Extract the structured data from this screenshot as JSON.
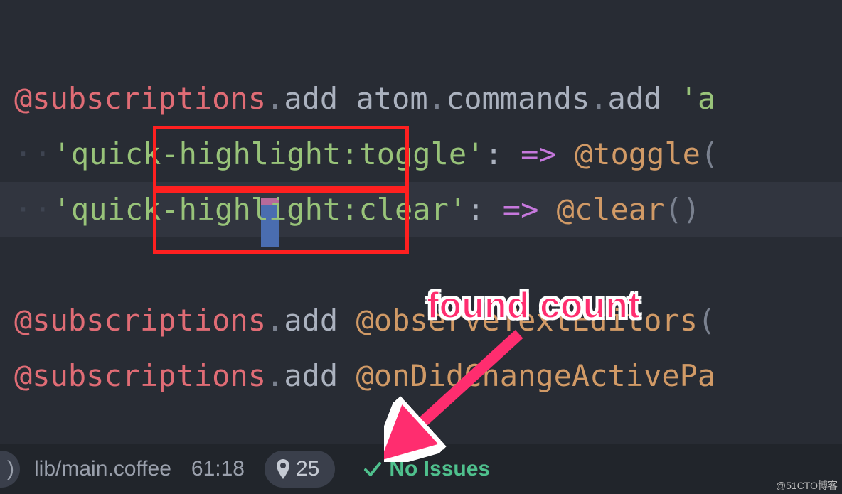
{
  "code": {
    "line1": {
      "at": "@",
      "subscriptions": "subscriptions",
      "dot1": ".",
      "add1": "add",
      "space1": " ",
      "atom": "atom",
      "dot2": ".",
      "commands": "commands",
      "dot3": ".",
      "add2": "add",
      "space2": " ",
      "quote": "'a"
    },
    "line2": {
      "indent": "··",
      "quote1": "'",
      "text": "quick-highlight:toggle",
      "quote2": "'",
      "colon": ":",
      "arrow": "=>",
      "at": "@",
      "toggle": "toggle",
      "paren": "("
    },
    "line3": {
      "indent": "··",
      "quote1": "'",
      "text": "quick-highlight:clear",
      "quote2": "'",
      "colon": ":",
      "arrow": "=>",
      "at": "@",
      "clear": "clear",
      "parens": "()"
    },
    "line4": {
      "at": "@",
      "subscriptions": "subscriptions",
      "dot": ".",
      "add": "add",
      "space": " ",
      "at2": "@",
      "observe": "observeTextEditors",
      "paren": "("
    },
    "line5": {
      "at": "@",
      "subscriptions": "subscriptions",
      "dot": ".",
      "add": "add",
      "space": " ",
      "at2": "@",
      "ondid": "onDidChangeActivePa"
    }
  },
  "annotation_label": "found count",
  "statusbar": {
    "edge": ")",
    "filepath": "lib/main.coffee",
    "cursor_pos": "61:18",
    "found_count": "25",
    "no_issues": "No Issues"
  },
  "watermark": "@51CTO博客"
}
